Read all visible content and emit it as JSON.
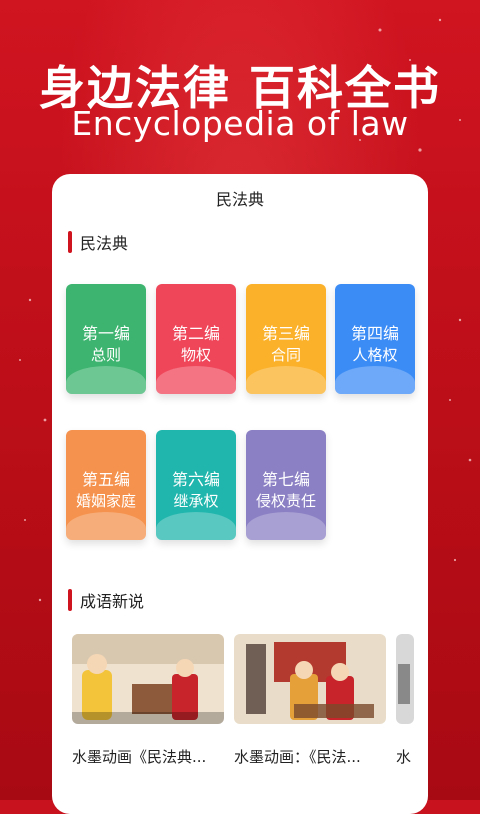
{
  "hero": {
    "title": "身边法律 百科全书",
    "subtitle": "Encyclopedia of law"
  },
  "card": {
    "title": "民法典"
  },
  "sections": {
    "code": "民法典",
    "idioms": "成语新说"
  },
  "tiles": [
    {
      "line1": "第一编",
      "line2": "总则",
      "color": "#3db46f"
    },
    {
      "line1": "第二编",
      "line2": "物权",
      "color": "#f0465a"
    },
    {
      "line1": "第三编",
      "line2": "合同",
      "color": "#fbb12a"
    },
    {
      "line1": "第四编",
      "line2": "人格权",
      "color": "#3c8cf6"
    },
    {
      "line1": "第五编",
      "line2": "婚姻家庭",
      "color": "#f5924d"
    },
    {
      "line1": "第六编",
      "line2": "继承权",
      "color": "#21b6ad"
    },
    {
      "line1": "第七编",
      "line2": "侵权责任",
      "color": "#8b80c4"
    }
  ],
  "videos": [
    {
      "caption": "水墨动画《民法典..."
    },
    {
      "caption": "水墨动画：《民法..."
    },
    {
      "caption": "水"
    }
  ],
  "colors": {
    "accent": "#d0141f",
    "background": "#c8121d"
  }
}
